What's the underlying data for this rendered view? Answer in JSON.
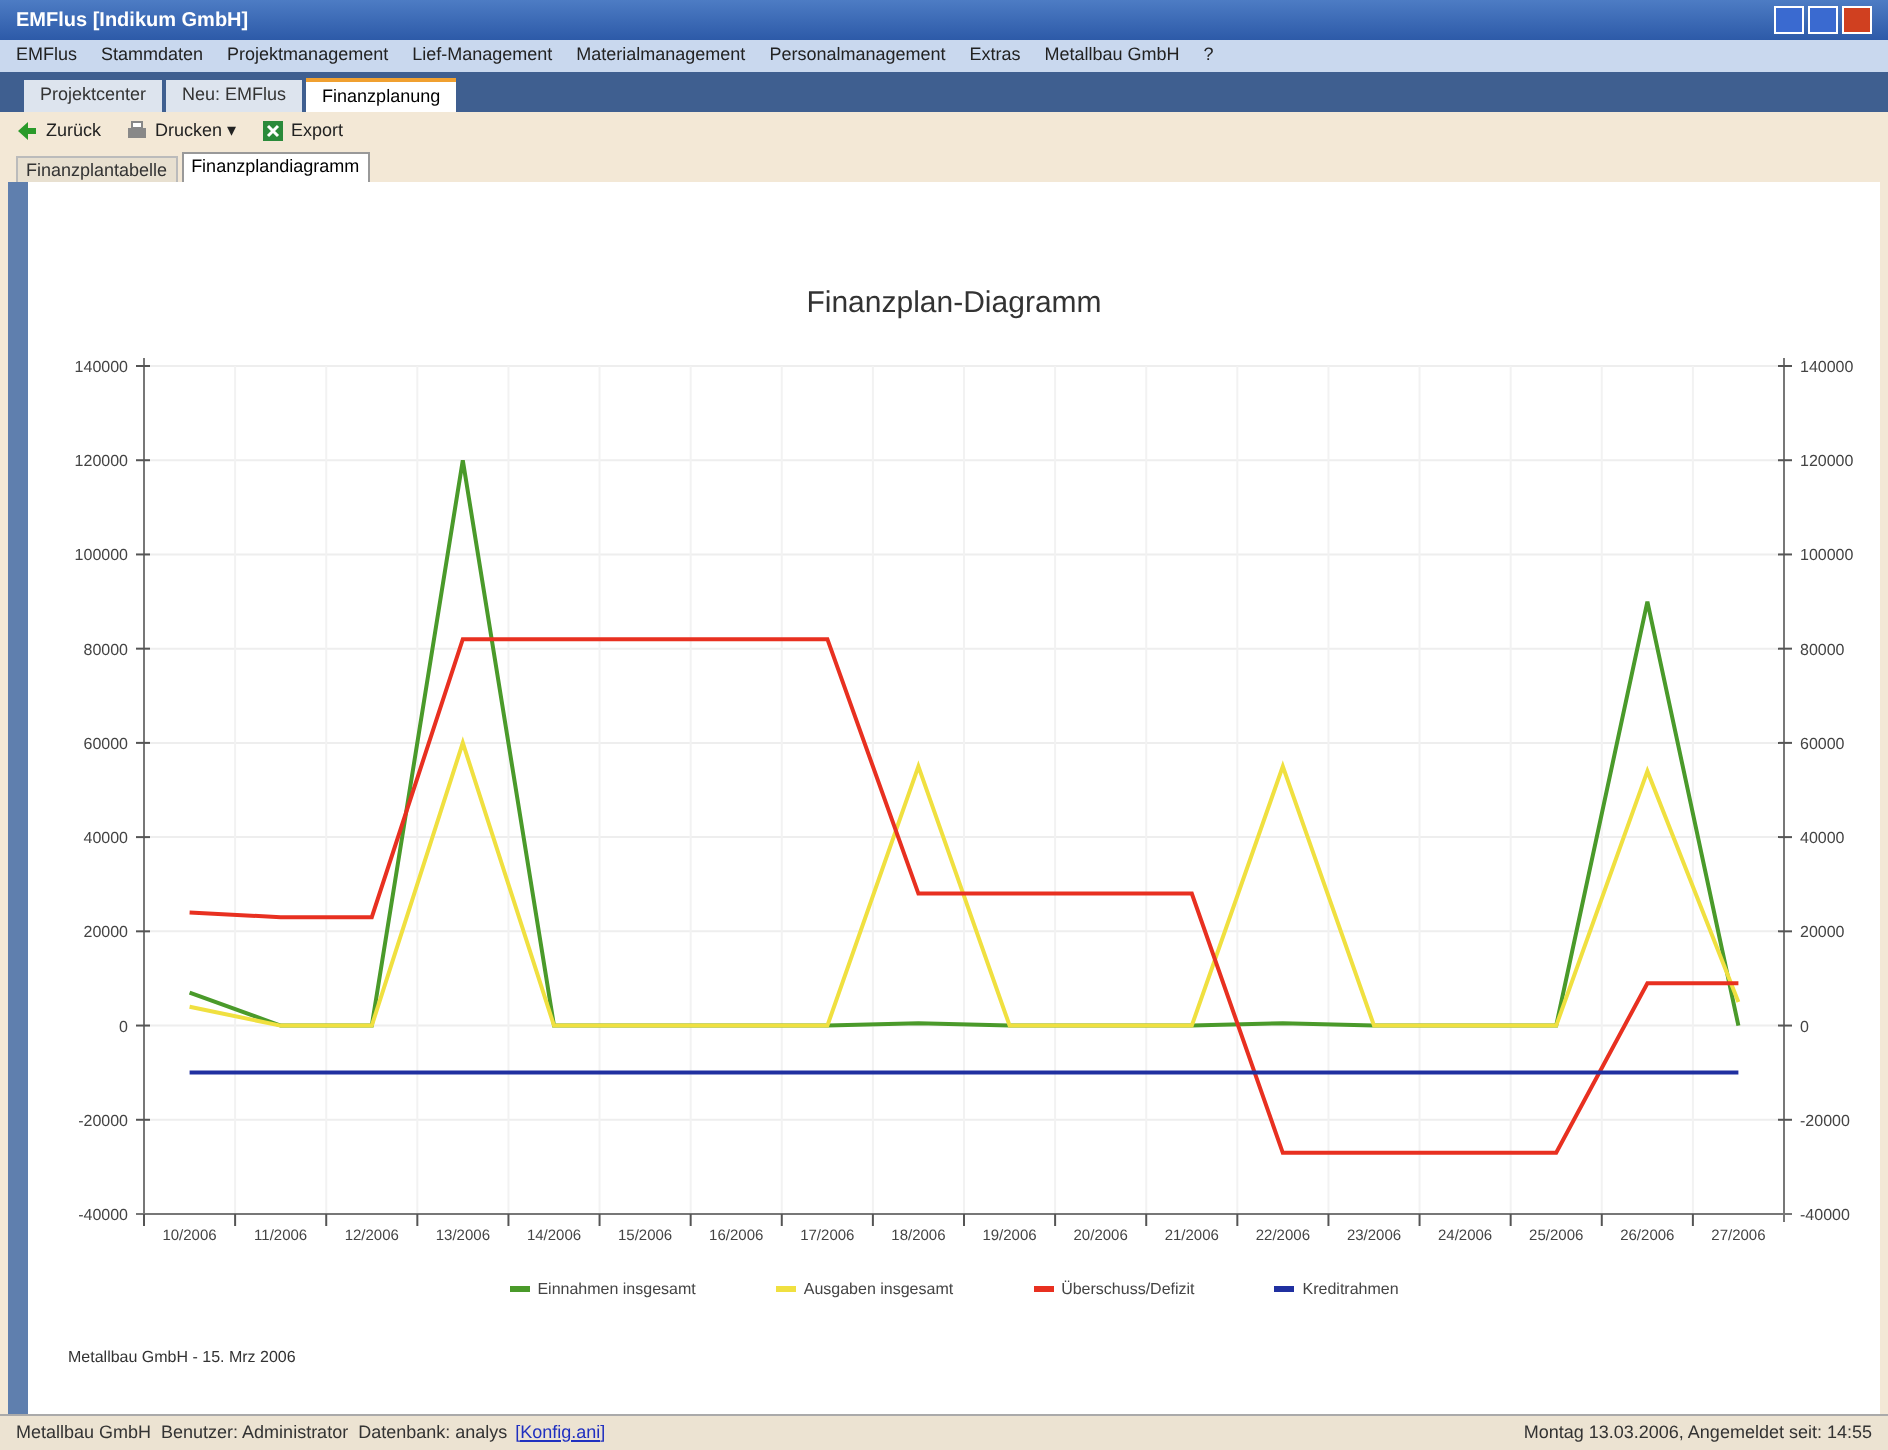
{
  "window": {
    "title": "EMFlus [Indikum GmbH]"
  },
  "menu": [
    "EMFlus",
    "Stammdaten",
    "Projektmanagement",
    "Lief-Management",
    "Materialmanagement",
    "Personalmanagement",
    "Extras",
    "Metallbau GmbH",
    "?"
  ],
  "tabs": [
    {
      "label": "Projektcenter",
      "selected": false
    },
    {
      "label": "Neu: EMFlus",
      "selected": false
    },
    {
      "label": "Finanzplanung",
      "selected": true
    }
  ],
  "toolbar": [
    {
      "label": "Zurück",
      "kind": "back"
    },
    {
      "label": "Drucken ▾",
      "kind": "print"
    },
    {
      "label": "Export",
      "kind": "export"
    }
  ],
  "subtabs": [
    {
      "label": "Finanzplantabelle",
      "selected": false
    },
    {
      "label": "Finanzplandiagramm",
      "selected": true
    }
  ],
  "chart": {
    "chart_data": {
      "type": "line",
      "title": "Finanzplan-Diagramm",
      "categories": [
        "10/2006",
        "11/2006",
        "12/2006",
        "13/2006",
        "14/2006",
        "15/2006",
        "16/2006",
        "17/2006",
        "18/2006",
        "19/2006",
        "20/2006",
        "21/2006",
        "22/2006",
        "23/2006",
        "24/2006",
        "25/2006",
        "26/2006",
        "27/2006"
      ],
      "series": [
        {
          "name": "Einnahmen insgesamt",
          "color": "#4a9a2a",
          "values": [
            7000,
            0,
            0,
            120000,
            0,
            0,
            0,
            0,
            500,
            0,
            0,
            0,
            500,
            0,
            0,
            0,
            90000,
            0
          ]
        },
        {
          "name": "Ausgaben insgesamt",
          "color": "#f0e040",
          "values": [
            4000,
            0,
            0,
            60000,
            0,
            0,
            0,
            0,
            55000,
            0,
            0,
            0,
            55000,
            0,
            0,
            0,
            54000,
            5000
          ]
        },
        {
          "name": "Überschuss/Defizit",
          "color": "#e83020",
          "values": [
            24000,
            23000,
            23000,
            82000,
            82000,
            82000,
            82000,
            82000,
            28000,
            28000,
            28000,
            28000,
            -27000,
            -27000,
            -27000,
            -27000,
            9000,
            9000
          ]
        },
        {
          "name": "Kreditrahmen",
          "color": "#2030a0",
          "values": [
            -10000,
            -10000,
            -10000,
            -10000,
            -10000,
            -10000,
            -10000,
            -10000,
            -10000,
            -10000,
            -10000,
            -10000,
            -10000,
            -10000,
            -10000,
            -10000,
            -10000,
            -10000
          ]
        }
      ],
      "ylim": [
        -40000,
        140000
      ],
      "grid": true,
      "y2lim": [
        -40000,
        140000
      ],
      "yticks": [
        -40000,
        -20000,
        0,
        20000,
        40000,
        60000,
        80000,
        100000,
        120000,
        140000
      ],
      "y2ticks": [
        -40000,
        -20000,
        0,
        20000,
        40000,
        60000,
        80000,
        100000,
        120000,
        140000
      ]
    },
    "footer": "Metallbau GmbH - 15. Mrz 2006"
  },
  "status_bar": {
    "left": "Metallbau GmbH  Benutzer: Administrator  Datenbank: analys",
    "link": "[Konfig.ani]",
    "right": "Montag 13.03.2006, Angemeldet seit: 14:55"
  }
}
